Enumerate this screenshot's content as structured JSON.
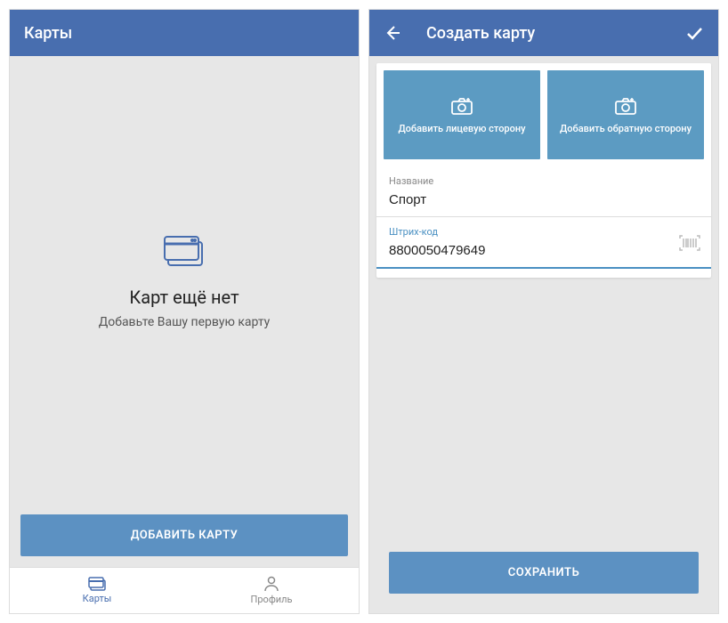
{
  "left": {
    "title": "Карты",
    "empty_title": "Карт ещё нет",
    "empty_sub": "Добавьте Вашу первую карту",
    "add_button": "ДОБАВИТЬ КАРТУ",
    "nav": {
      "cards": "Карты",
      "profile": "Профиль"
    }
  },
  "right": {
    "title": "Создать карту",
    "photo_front": "Добавить лицевую сторону",
    "photo_back": "Добавить обратную сторону",
    "field_name_label": "Название",
    "field_name_value": "Спорт",
    "field_barcode_label": "Штрих-код",
    "field_barcode_value": "8800050479649",
    "save_button": "СОХРАНИТЬ"
  }
}
